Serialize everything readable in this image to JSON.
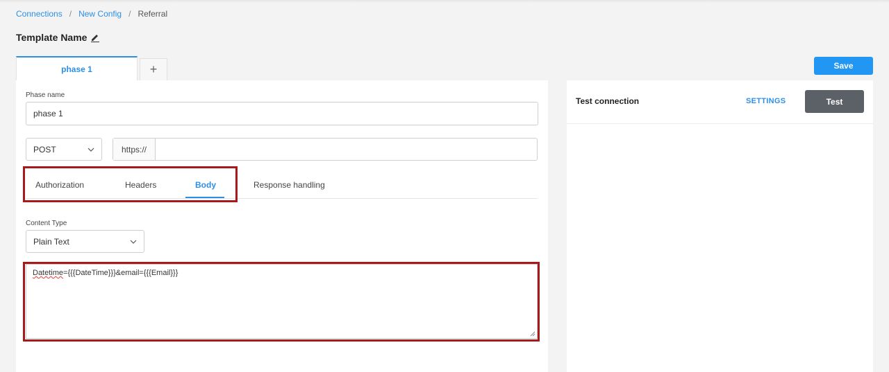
{
  "breadcrumb": {
    "items": [
      {
        "label": "Connections"
      },
      {
        "label": "New Config"
      },
      {
        "label": "Referral"
      }
    ],
    "separator": "/"
  },
  "template": {
    "title": "Template Name",
    "edit_icon": "pencil-icon"
  },
  "phase_tabs": {
    "items": [
      {
        "label": "phase 1",
        "active": true
      }
    ],
    "add_label": "+"
  },
  "toolbar": {
    "save_label": "Save"
  },
  "phase_form": {
    "phase_name_label": "Phase name",
    "phase_name_value": "phase 1",
    "method_value": "POST",
    "url_prefix": "https://",
    "url_value": ""
  },
  "request_tabs": {
    "items": [
      {
        "label": "Authorization",
        "active": false
      },
      {
        "label": "Headers",
        "active": false
      },
      {
        "label": "Body",
        "active": true
      },
      {
        "label": "Response handling",
        "active": false
      }
    ]
  },
  "body": {
    "content_type_label": "Content Type",
    "content_type_value": "Plain Text",
    "text_underlined": "Datetime",
    "text_rest": "={{{DateTime}}}&email={{{Email}}}"
  },
  "test_panel": {
    "title": "Test connection",
    "settings_label": "SETTINGS",
    "test_label": "Test"
  },
  "colors": {
    "accent": "#2c8fe6",
    "save_button": "#2196f3",
    "test_button": "#5c6067",
    "highlight": "#a8191b"
  }
}
